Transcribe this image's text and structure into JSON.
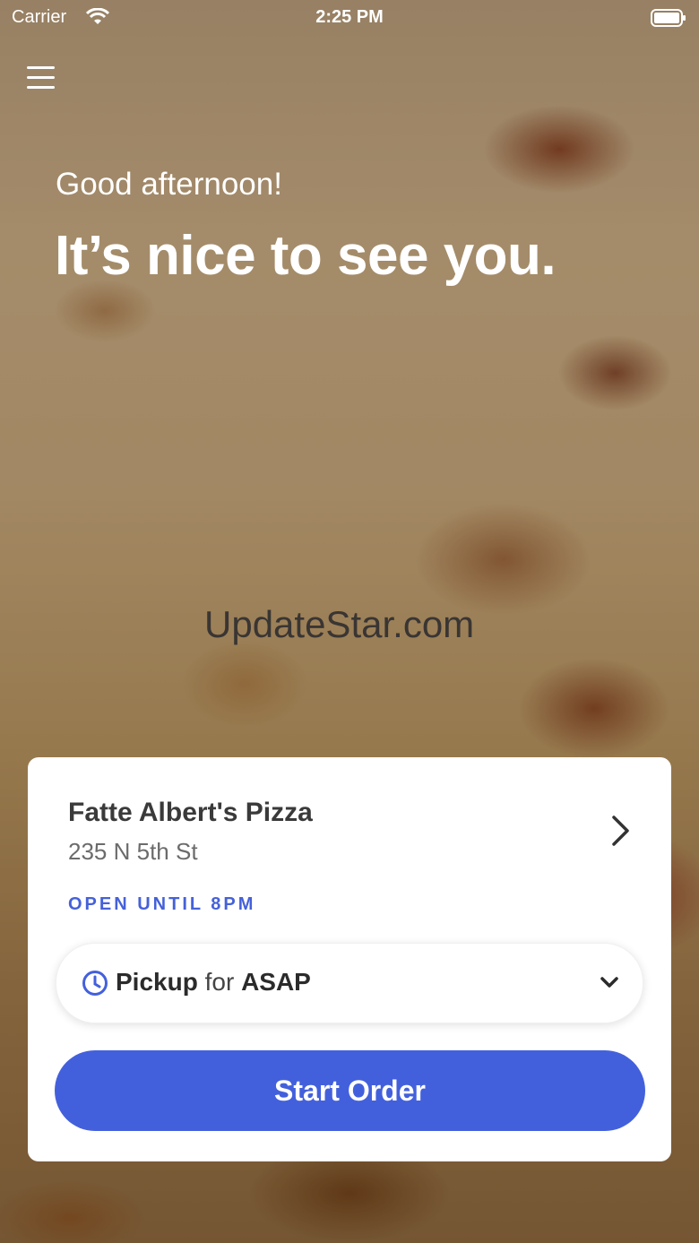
{
  "status_bar": {
    "carrier": "Carrier",
    "time": "2:25 PM"
  },
  "header": {
    "menu_icon": "hamburger-menu-icon"
  },
  "hero": {
    "greeting": "Good afternoon!",
    "headline": "It’s nice to see you."
  },
  "watermark": "UpdateStar.com",
  "store_card": {
    "name": "Fatte Albert's Pizza",
    "address": "235 N 5th St",
    "status": "OPEN UNTIL 8PM",
    "pickup": {
      "mode": "Pickup",
      "connector": "for",
      "time": "ASAP"
    },
    "start_order_label": "Start Order"
  },
  "colors": {
    "accent": "#4360dc",
    "status_text": "#4561d9"
  }
}
